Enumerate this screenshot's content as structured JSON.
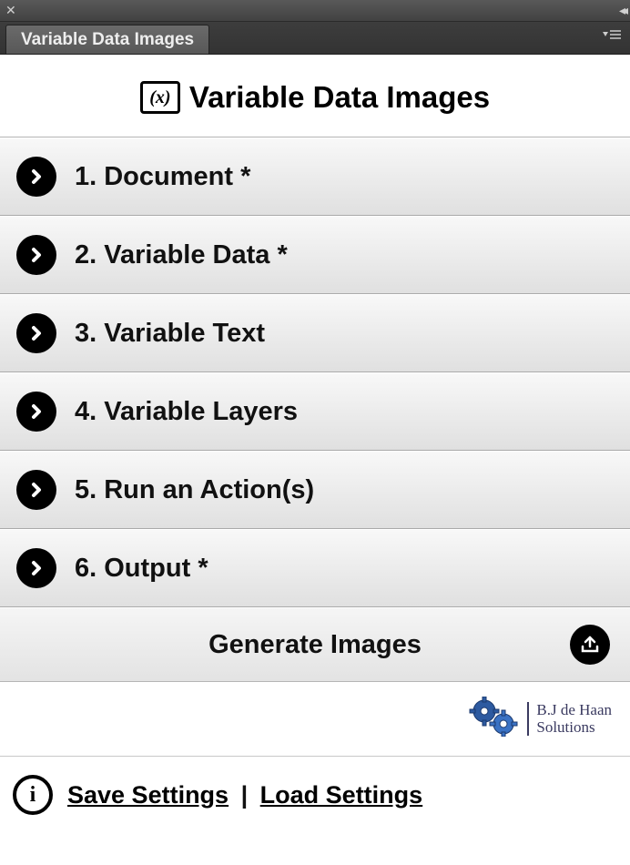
{
  "tab_title": "Variable Data Images",
  "panel_title": "Variable Data Images",
  "var_icon_text": "(x)",
  "accordion": [
    {
      "label": "1. Document *"
    },
    {
      "label": "2. Variable Data *"
    },
    {
      "label": "3. Variable Text"
    },
    {
      "label": "4. Variable Layers"
    },
    {
      "label": "5. Run an Action(s)"
    },
    {
      "label": "6. Output *"
    }
  ],
  "generate_label": "Generate Images",
  "logo": {
    "line1": "B.J de Haan",
    "line2": "Solutions"
  },
  "footer": {
    "save": "Save Settings",
    "sep": "|",
    "load": "Load Settings"
  }
}
